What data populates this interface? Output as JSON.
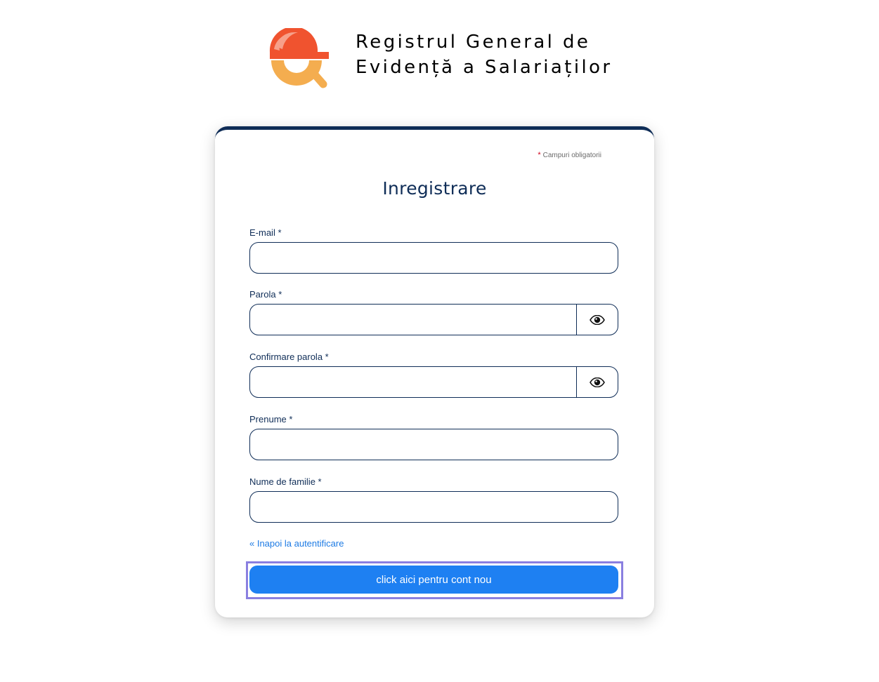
{
  "brand": {
    "title_line1": "Registrul General de",
    "title_line2": "Evidență a Salariaților",
    "logo_icon": "hardhat-magnifier-icon",
    "colors": {
      "helmet": "#f0532f",
      "helmet_highlight": "#f7a08a",
      "lens": "#f4ad4f"
    }
  },
  "form": {
    "required_note_star": "*",
    "required_note": "Campuri obligatorii",
    "title": "Inregistrare",
    "fields": {
      "email": {
        "label": "E-mail *",
        "value": "",
        "placeholder": ""
      },
      "password": {
        "label": "Parola *",
        "value": "",
        "placeholder": "",
        "toggle_icon": "eye-icon"
      },
      "confirm_password": {
        "label": "Confirmare parola *",
        "value": "",
        "placeholder": "",
        "toggle_icon": "eye-icon"
      },
      "first_name": {
        "label": "Prenume *",
        "value": "",
        "placeholder": ""
      },
      "last_name": {
        "label": "Nume de familie *",
        "value": "",
        "placeholder": ""
      }
    },
    "back_link": "« Inapoi la autentificare",
    "submit_label": "click aici pentru cont nou"
  },
  "colors": {
    "primary": "#1e80f2",
    "navy": "#0f2d57",
    "link": "#1e7be4",
    "required_star": "#d0021b",
    "focus_ring": "#8a7fe0"
  }
}
